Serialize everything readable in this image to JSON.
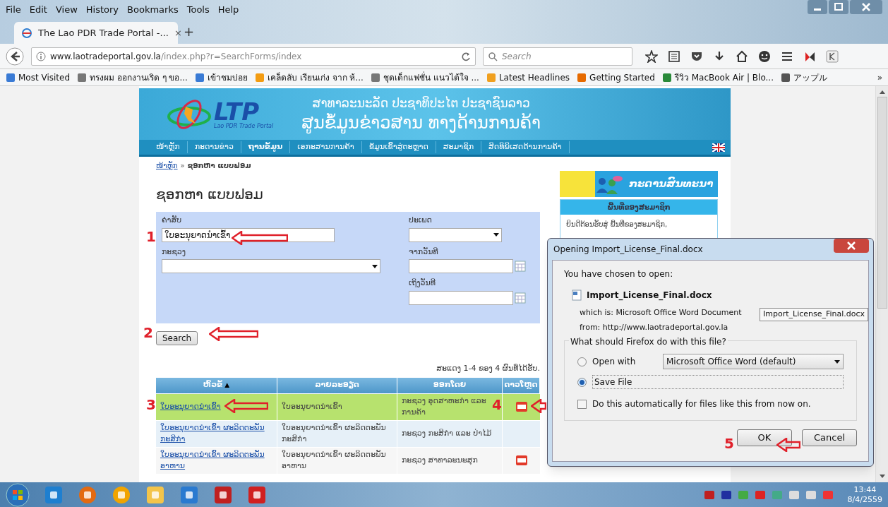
{
  "browser": {
    "menu": [
      "File",
      "Edit",
      "View",
      "History",
      "Bookmarks",
      "Tools",
      "Help"
    ],
    "tab_title": "The Lao PDR Trade Portal -...",
    "tab_close": "×",
    "new_tab": "+",
    "url_host": "www.laotradeportal.gov.la",
    "url_path": "/index.php?r=SearchForms/index",
    "search_placeholder": "Search",
    "bookmarks": [
      "Most Visited",
      "ทรงผม ออกงานเริด ๆ ขอ...",
      "เข้าชมบ่อย",
      "เคล็ดลับ เรียนเก่ง จาก ห้...",
      "ชุดเด็กแฟชั่น แนวไต้ใจ ...",
      "Latest Headlines",
      "Getting Started",
      "รีวิว MacBook Air | Blo...",
      "アップル"
    ],
    "bookmarks_overflow": "»"
  },
  "site": {
    "logo_text": "LTP",
    "logo_sub": "Lao PDR Trade Portal",
    "header_line1": "ສາທາລະນະລັດ ປະຊາທິປະໄຕ ປະຊາຊົນລາວ",
    "header_line2": "ສູນຂໍ້ມູນຂ່າວສານ ທາງດ້ານການຄ້າ",
    "nav": [
      {
        "label": "ໜ້າຫຼັກ",
        "selected": false
      },
      {
        "label": "ກະດານຂ່າວ",
        "selected": false
      },
      {
        "label": "ຖານຂໍ້ມູນ",
        "selected": true
      },
      {
        "label": "ເອກະສານການຄ້າ",
        "selected": false
      },
      {
        "label": "ຂໍ້ມູນເຂົ້າສູ່ຕະຫຼາດ",
        "selected": false
      },
      {
        "label": "ສະມາຊິກ",
        "selected": false
      },
      {
        "label": "ສິດທິພິເສດດ້ານການຄ້າ",
        "selected": false
      }
    ],
    "breadcrumb": {
      "link": "ໜ້າຫຼັກ",
      "separator": "»",
      "current": "ຊອກຫາ ແບບຟອມ"
    },
    "title": "ຊອກຫາ ແບບຟອມ",
    "form": {
      "keyword": {
        "label": "ຄຳສັບ",
        "value": "ໃບອະນຸຍາດນຳເຂົ້າ"
      },
      "type": {
        "label": "ປະເພດ"
      },
      "ministry": {
        "label": "ກະຊວງ"
      },
      "date_from": {
        "label": "ຈາກວັນທີ"
      },
      "date_to": {
        "label": "ເຖິງວັນທີ"
      }
    },
    "search_button": "Search",
    "results_summary": "ສະແດງ 1-4 ຂອງ 4 ຜົນທີ່ໄດ້ຮັບ.",
    "table": {
      "columns": [
        "ຫົວຂໍ້",
        "ລາຍລະອຽດ",
        "ອອກໂດຍ",
        "ດາວໂຫຼດ"
      ],
      "sort_mark": "▲",
      "rows": [
        {
          "title": "ໃບອະນຸຍາດນຳເຂົ້າ",
          "details": "ໃບອະນຸຍາດນຳເຂົ້າ",
          "issued_by": "ກະຊວງ ອຸດສາຫະກຳ ແລະ ການຄ້າ",
          "download": true,
          "selected": true
        },
        {
          "title": "ໃບອະນຸຍາດນຳເຂົ້າ ຜະລິດຕະພັນກະສິກຳ",
          "details": "ໃບອະນຸຍາດນຳເຂົ້າ ຜະລິດຕະພັນກະສິກຳ",
          "issued_by": "ກະຊວງ ກະສິກຳ ແລະ ປ່າໄມ້",
          "download": false,
          "selected": false
        },
        {
          "title": "ໃບອະນຸຍາດນຳເຂົ້າ ຜະລິດຕະພັນອາຫານ",
          "details": "ໃບອະນຸຍາດນຳເຂົ້າ ຜະລິດຕະພັນອາຫານ",
          "issued_by": "ກະຊວງ ສາທາລະນະສຸກ",
          "download": true,
          "selected": false
        }
      ]
    },
    "sidebar": {
      "banner_title": "ກະດານສົນທະນາ",
      "panel_title": "ພື້ນທີ່ຂອງສະມາຊິກ",
      "panel_text": "ຍິນດີຕ້ອນຮັບສູ່ ພື້ນທີ່ຂອງສະມາຊິກ,"
    }
  },
  "dialog": {
    "title": "Opening Import_License_Final.docx",
    "intro": "You have chosen to open:",
    "file_name": "Import_License_Final.docx",
    "which_is": "which is:  Microsoft Office Word Document",
    "from": "from:  http://www.laotradeportal.gov.la",
    "tooltip": "Import_License_Final.docx",
    "question": "What should Firefox do with this file?",
    "options": [
      {
        "label": "Open with",
        "selected": false
      },
      {
        "label": "Save File",
        "selected": true
      }
    ],
    "app_select": "Microsoft Office Word (default)",
    "auto_checkbox": {
      "label": "Do this automatically for files like this from now on.",
      "checked": false
    },
    "buttons": [
      "OK",
      "Cancel"
    ]
  },
  "annotations": [
    "1",
    "2",
    "3",
    "4",
    "5"
  ],
  "taskbar": {
    "time": "13:44",
    "date": "8/4/2559"
  }
}
